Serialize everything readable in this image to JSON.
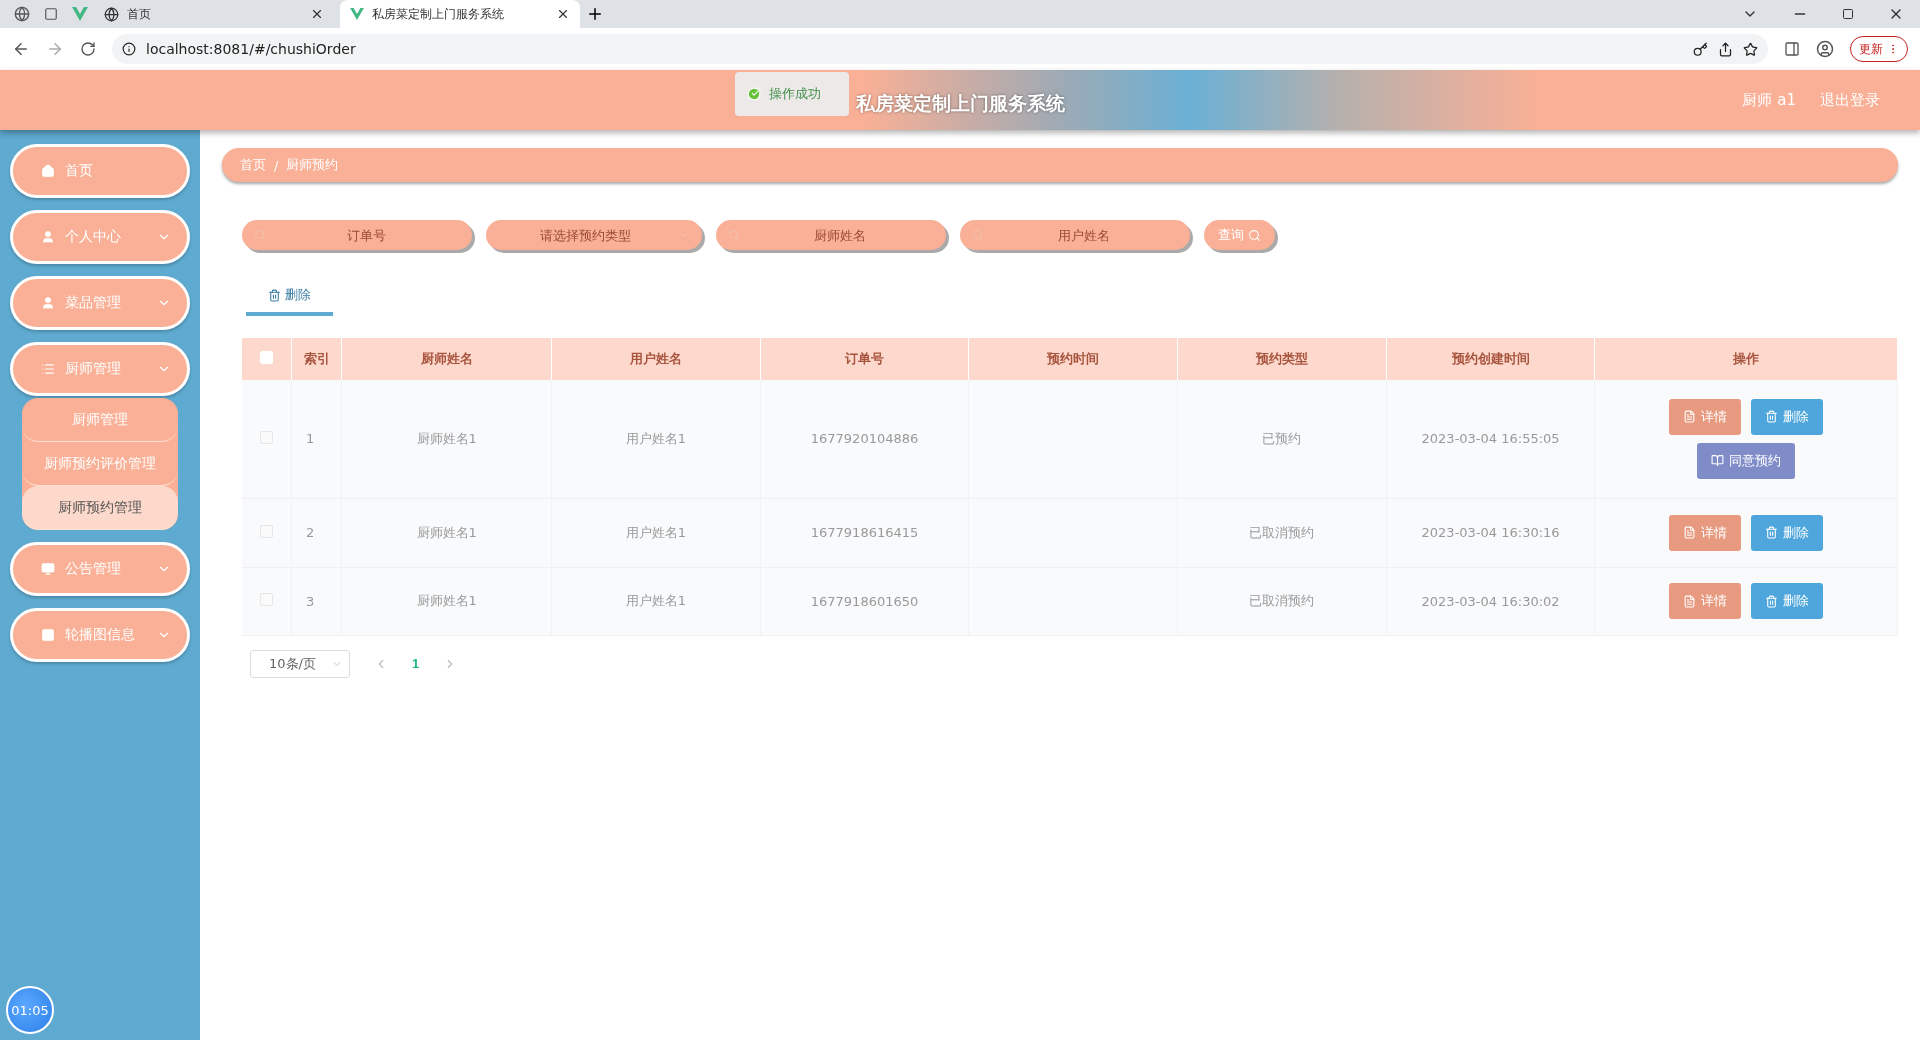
{
  "browser": {
    "tabs": [
      {
        "title": "首页",
        "selected": false
      },
      {
        "title": "私房菜定制上门服务系统",
        "selected": true
      }
    ],
    "address": "localhost:8081/#/chushiOrder",
    "update_button": "更新"
  },
  "header": {
    "title": "私房菜定制上门服务系统",
    "user": "厨师 a1",
    "logout": "退出登录"
  },
  "toast": {
    "message": "操作成功"
  },
  "sidebar": {
    "items": [
      {
        "label": "首页",
        "expandable": false
      },
      {
        "label": "个人中心",
        "expandable": true
      },
      {
        "label": "菜品管理",
        "expandable": true
      },
      {
        "label": "厨师管理",
        "expandable": true,
        "children": [
          {
            "label": "厨师管理",
            "selected": false
          },
          {
            "label": "厨师预约评价管理",
            "selected": false
          },
          {
            "label": "厨师预约管理",
            "selected": true
          }
        ]
      },
      {
        "label": "公告管理",
        "expandable": true
      },
      {
        "label": "轮播图信息",
        "expandable": true
      }
    ]
  },
  "timer": "01:05",
  "breadcrumb": {
    "items": [
      "首页",
      "厨师预约"
    ],
    "separator": "/"
  },
  "search": {
    "fields": [
      {
        "kind": "input",
        "placeholder": "订单号"
      },
      {
        "kind": "select",
        "placeholder": "请选择预约类型"
      },
      {
        "kind": "input",
        "placeholder": "厨师姓名"
      },
      {
        "kind": "input",
        "placeholder": "用户姓名"
      }
    ],
    "button": "查询"
  },
  "toolbar": {
    "delete_tab": "删除"
  },
  "table": {
    "select_all_checked": false,
    "columns": [
      "索引",
      "厨师姓名",
      "用户姓名",
      "订单号",
      "预约时间",
      "预约类型",
      "预约创建时间",
      "操作"
    ],
    "rows": [
      {
        "checked": false,
        "index": "1",
        "chef": "厨师姓名1",
        "user": "用户姓名1",
        "order": "1677920104886",
        "type": "已预约",
        "created": "2023-03-04 16:55:05",
        "actions": [
          {
            "kind": "detail",
            "label": "详情"
          },
          {
            "kind": "delete",
            "label": "删除"
          },
          {
            "kind": "agree",
            "label": "同意预约"
          }
        ]
      },
      {
        "checked": false,
        "index": "2",
        "chef": "厨师姓名1",
        "user": "用户姓名1",
        "order": "1677918616415",
        "type": "已取消预约",
        "created": "2023-03-04 16:30:16",
        "actions": [
          {
            "kind": "detail",
            "label": "详情"
          },
          {
            "kind": "delete",
            "label": "删除"
          }
        ]
      },
      {
        "checked": false,
        "index": "3",
        "chef": "厨师姓名1",
        "user": "用户姓名1",
        "order": "1677918601650",
        "type": "已取消预约",
        "created": "2023-03-04 16:30:02",
        "actions": [
          {
            "kind": "detail",
            "label": "详情"
          },
          {
            "kind": "delete",
            "label": "删除"
          }
        ]
      }
    ]
  },
  "pagination": {
    "page_size": "10条/页",
    "pages": [
      {
        "label": "1",
        "selected": true
      }
    ]
  }
}
